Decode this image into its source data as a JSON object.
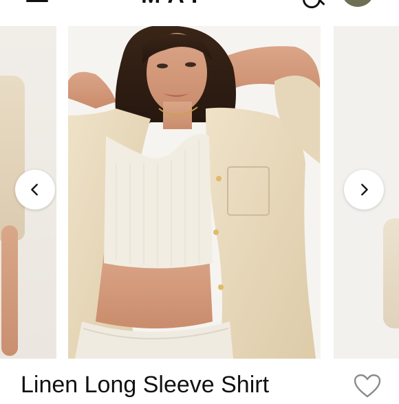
{
  "header": {
    "logo_fragment": "MAF",
    "menu_icon": "hamburger-icon",
    "search_icon": "search-icon",
    "avatar_color": "#6f6f55"
  },
  "carousel": {
    "prev_icon": "chevron-left-icon",
    "next_icon": "chevron-right-icon"
  },
  "product": {
    "title": "Linen Long Sleeve Shirt",
    "like_icon": "heart-outline-icon"
  }
}
